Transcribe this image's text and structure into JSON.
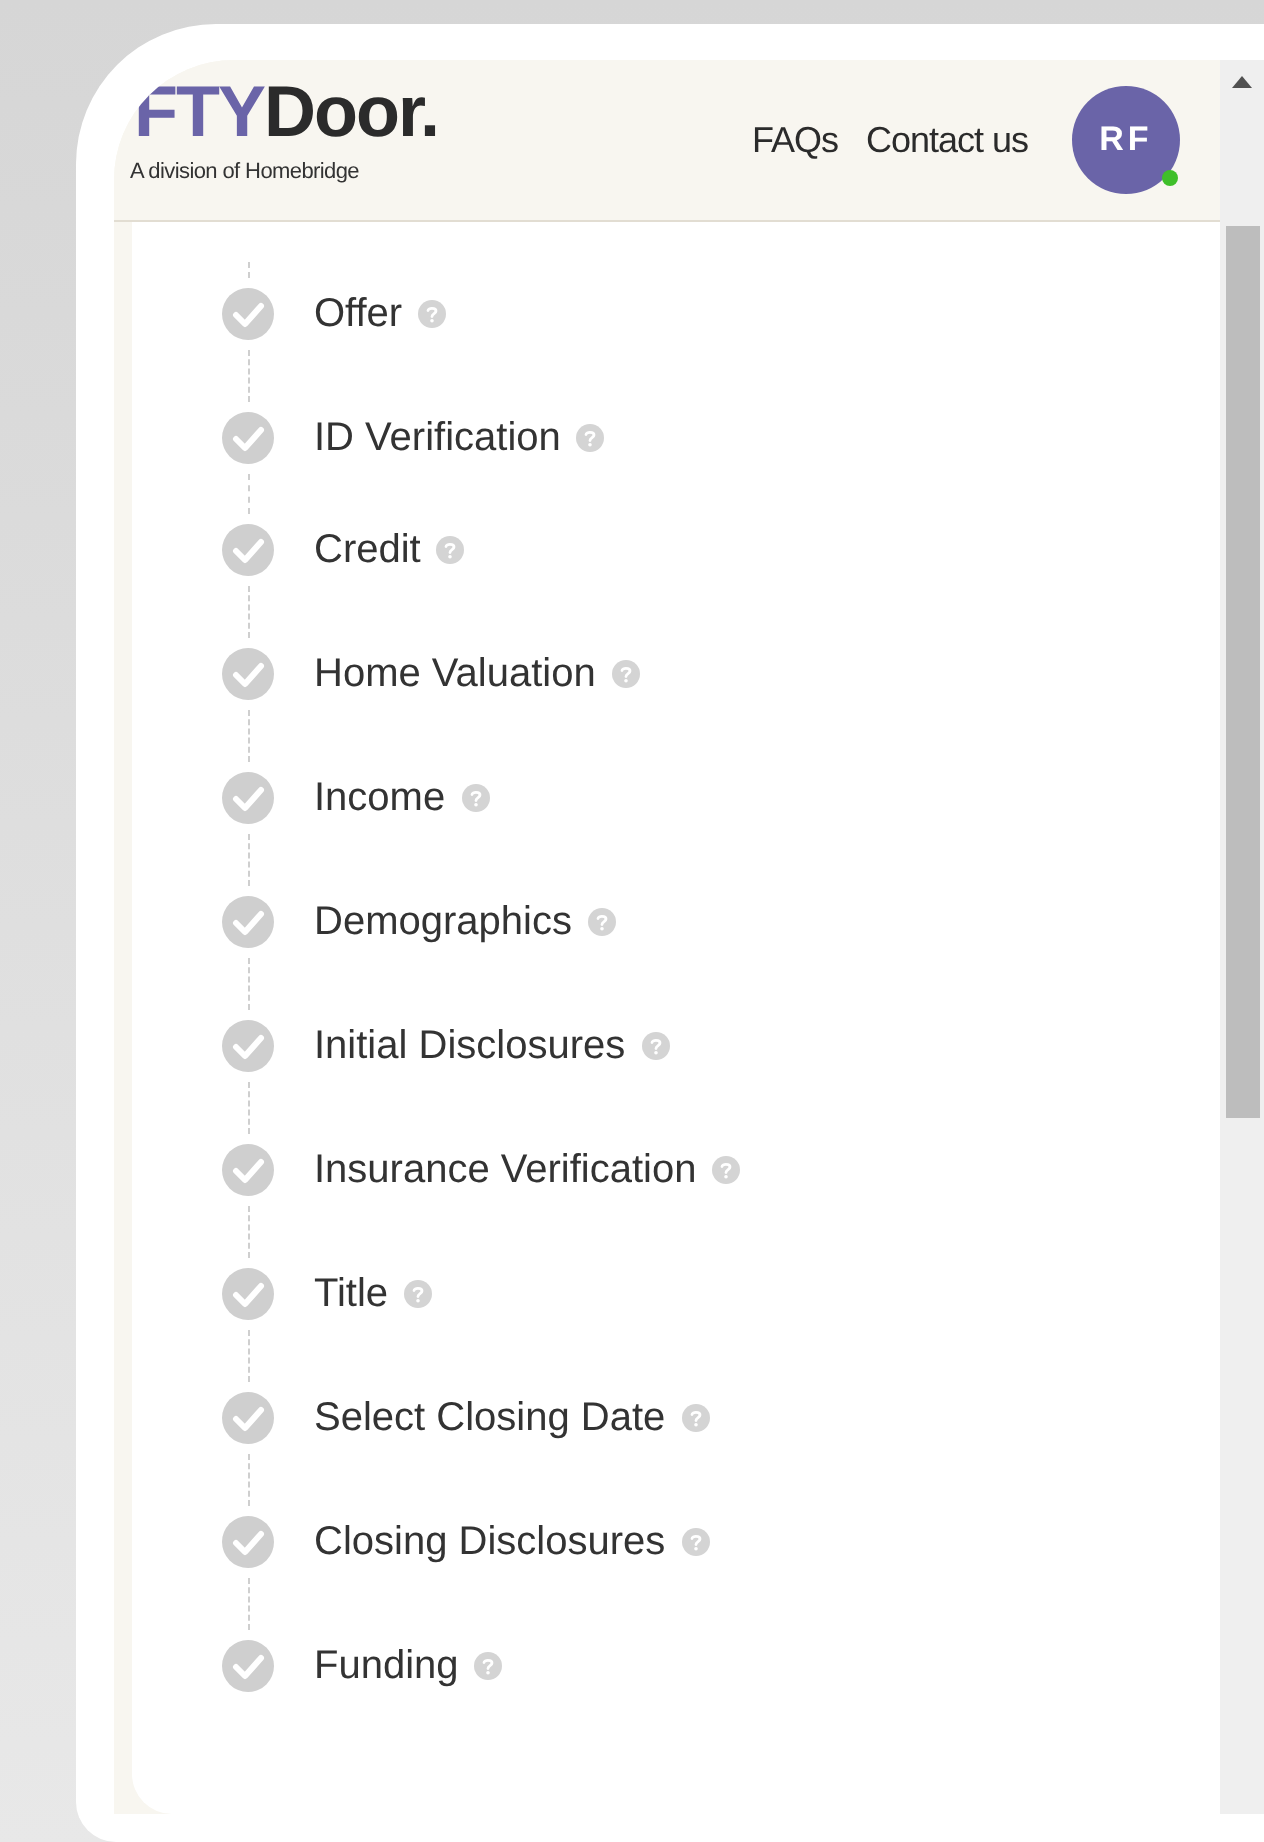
{
  "header": {
    "logo": {
      "part_1": "FTY",
      "part_2": "Door.",
      "tagline": "A division of Homebridge"
    },
    "nav": [
      "FAQs",
      "Contact us"
    ],
    "avatar": {
      "initials": "RF",
      "online": true
    }
  },
  "steps": [
    {
      "label": "Offer",
      "completed": true
    },
    {
      "label": "ID Verification",
      "completed": true
    },
    {
      "label": "Credit",
      "completed": true
    },
    {
      "label": "Home Valuation",
      "completed": true
    },
    {
      "label": "Income",
      "completed": true
    },
    {
      "label": "Demographics",
      "completed": true
    },
    {
      "label": "Initial Disclosures",
      "completed": true
    },
    {
      "label": "Insurance Verification",
      "completed": true
    },
    {
      "label": "Title",
      "completed": true
    },
    {
      "label": "Select Closing Date",
      "completed": true
    },
    {
      "label": "Closing Disclosures",
      "completed": true
    },
    {
      "label": "Funding",
      "completed": true
    }
  ]
}
